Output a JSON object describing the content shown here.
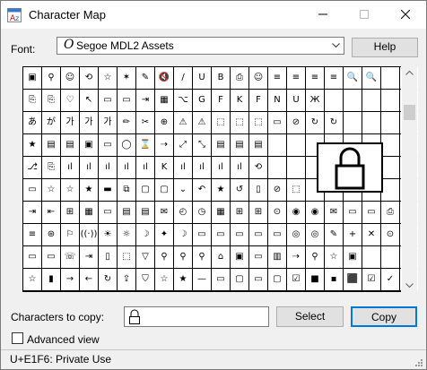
{
  "window": {
    "title": "Character Map",
    "icon": "character-map-app-icon"
  },
  "font": {
    "label": "Font:",
    "selected": "Segoe MDL2 Assets",
    "glyph": "O",
    "help_label": "Help"
  },
  "grid": {
    "rows": [
      [
        "▣",
        "⚲",
        "☺",
        "⟲",
        "☆",
        "✶",
        "✎",
        "🔇",
        "/",
        "U",
        "B",
        "⎙",
        "☺",
        "≡",
        "≡",
        "≡",
        "≡",
        "🔍",
        "🔍",
        "",
        ""
      ],
      [
        "⎘",
        "⎘",
        "♡",
        "↖",
        "▭",
        "▭",
        "⇥",
        "▦",
        "⌥",
        "G",
        "F",
        "K",
        "F",
        "N",
        "U",
        "Ж",
        "",
        "",
        "",
        "",
        ""
      ],
      [
        "あ",
        "が",
        "가",
        "가",
        "가",
        "✏",
        "✂",
        "⊕",
        "⚠",
        "⚠",
        "⬚",
        "⬚",
        "⬚",
        "▭",
        "⊘",
        "↻",
        "↻",
        "",
        "",
        "",
        ""
      ],
      [
        "★",
        "▤",
        "▤",
        "▣",
        "▭",
        "◯",
        "⌛",
        "⇢",
        "⤢",
        "⤡",
        "▤",
        "▤",
        "▤",
        "",
        "",
        "",
        "",
        "",
        "",
        "",
        ""
      ],
      [
        "⎇",
        "⎘",
        "ıl",
        "ıl",
        "ıl",
        "ıl",
        "ıl",
        "K",
        "ıl",
        "ıl",
        "ıl",
        "ıl",
        "⟲",
        "",
        "",
        "",
        "",
        "",
        "",
        "",
        ""
      ],
      [
        "▭",
        "☆",
        "☆",
        "★",
        "▬",
        "⧉",
        "▢",
        "▢",
        "⌄",
        "↶",
        "★",
        "↺",
        "▯",
        "⊘",
        "⬚",
        "",
        "",
        "",
        "",
        "",
        ""
      ],
      [
        "⇥",
        "⇤",
        "⊞",
        "▦",
        "▭",
        "▤",
        "▤",
        "✉",
        "◴",
        "◷",
        "▦",
        "⊞",
        "⊞",
        "⊙",
        "◉",
        "◉",
        "✉",
        "▭",
        "▭",
        "⎙",
        "⎙"
      ],
      [
        "≡",
        "⊛",
        "⚐",
        "((·))",
        "☀",
        "☼",
        "☽",
        "✦",
        "☽",
        "▭",
        "▭",
        "▭",
        "▭",
        "▭",
        "◎",
        "◎",
        "✎",
        "+",
        "✕",
        "⊙",
        ""
      ],
      [
        "▭",
        "▭",
        "☏",
        "⇥",
        "▯",
        "⬚",
        "▽",
        "⚲",
        "⚲",
        "⚲",
        "⌂",
        "▣",
        "▭",
        "▥",
        "⇢",
        "⚲",
        "☆",
        "▣",
        "",
        "",
        ""
      ],
      [
        "☆",
        "▮",
        "→",
        "←",
        "↻",
        "⇪",
        "⛉",
        "☆",
        "★",
        "—",
        "▭",
        "▢",
        "▭",
        "▢",
        "☑",
        "■",
        "▪",
        "⬛",
        "☑",
        "✓",
        ""
      ]
    ]
  },
  "zoom": {
    "glyph": "lock"
  },
  "copy": {
    "label": "Characters to copy:",
    "value_glyph": "lock",
    "select_label": "Select",
    "copy_label": "Copy"
  },
  "advanced": {
    "label": "Advanced view",
    "checked": false
  },
  "status": {
    "text": "U+E1F6: Private Use"
  },
  "colors": {
    "focus_border": "#0078d7",
    "window_bg": "#f0f0f0"
  }
}
